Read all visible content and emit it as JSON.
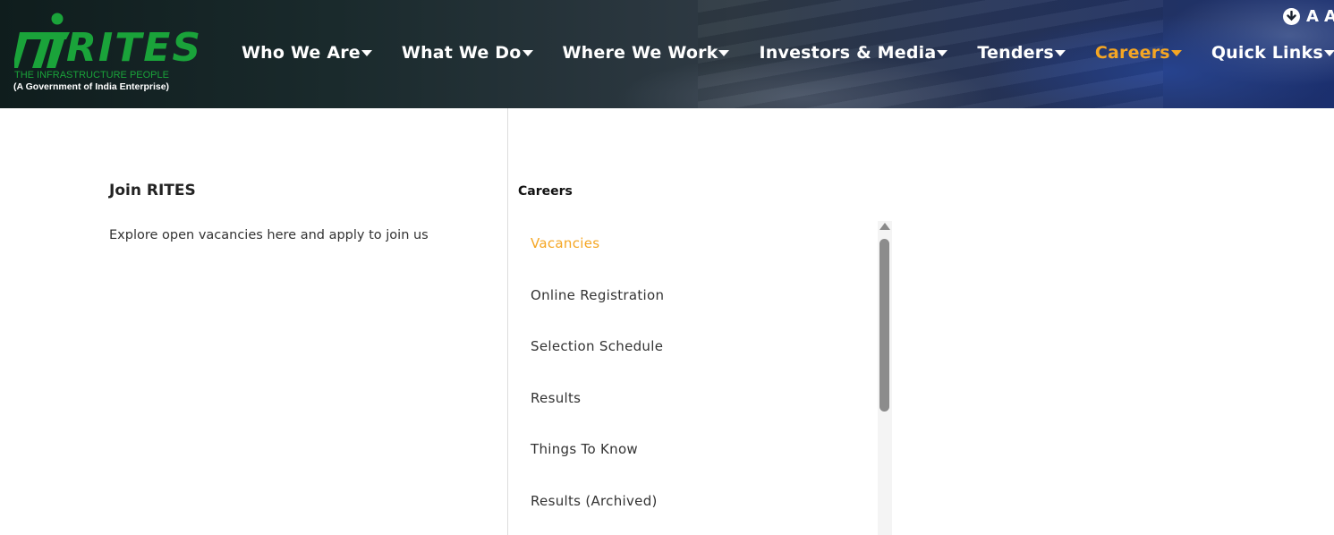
{
  "header": {
    "logo": {
      "wordmark": "RITES",
      "tagline": "THE INFRASTRUCTURE PEOPLE",
      "subtitle": "(A Government of India Enterprise)"
    },
    "nav": [
      {
        "label": "Who We Are",
        "active": false
      },
      {
        "label": "What We Do",
        "active": false
      },
      {
        "label": "Where We Work",
        "active": false
      },
      {
        "label": "Investors & Media",
        "active": false
      },
      {
        "label": "Tenders",
        "active": false
      },
      {
        "label": "Careers",
        "active": true
      },
      {
        "label": "Quick Links",
        "active": false
      }
    ],
    "accessibility": {
      "icon": "download-circle-icon",
      "a1": "A",
      "a2": "A"
    }
  },
  "menu": {
    "left": {
      "title": "Join RITES",
      "description": "Explore open vacancies here and apply to join us"
    },
    "right": {
      "title": "Careers",
      "links": [
        {
          "label": "Vacancies",
          "active": true
        },
        {
          "label": "Online Registration",
          "active": false
        },
        {
          "label": "Selection Schedule",
          "active": false
        },
        {
          "label": "Results",
          "active": false
        },
        {
          "label": "Things To Know",
          "active": false
        },
        {
          "label": "Results (Archived)",
          "active": false
        }
      ]
    }
  },
  "colors": {
    "accent": "#f5a623",
    "brand_green": "#1aa33a",
    "text_dark": "#222222"
  }
}
